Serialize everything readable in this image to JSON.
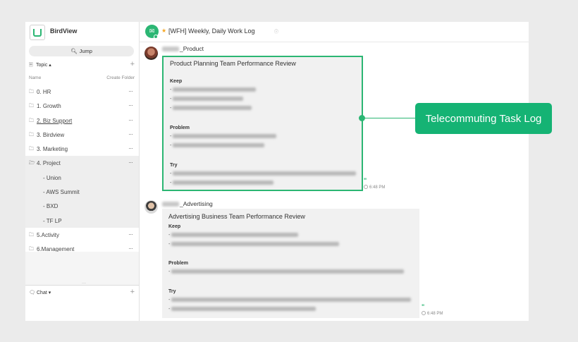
{
  "sidebar": {
    "app_name": "BirdView",
    "jump_label": "Jump",
    "topic_label": "Topic ▴",
    "col_name": "Name",
    "col_create": "Create Folder",
    "items": [
      {
        "label": "0. HR"
      },
      {
        "label": "1. Growth"
      },
      {
        "label": "2. Biz Support"
      },
      {
        "label": "3. Birdview"
      },
      {
        "label": "3. Marketing"
      },
      {
        "label": "4. Project"
      },
      {
        "label": "Union"
      },
      {
        "label": "AWS Summit"
      },
      {
        "label": "BXD"
      },
      {
        "label": "TF LP"
      },
      {
        "label": "5.Activity"
      },
      {
        "label": "6.Management"
      }
    ],
    "chat_label": "Chat ▾"
  },
  "header": {
    "title": "[WFH] Weekly, Daily Work Log"
  },
  "messages": [
    {
      "sender": "_Product",
      "title": "Product Planning Team Performance Review",
      "sections": [
        "Keep",
        "Problem",
        "Try"
      ],
      "time": "6:48 PM"
    },
    {
      "sender": "_Advertising",
      "title": "Advertising Business Team Performance Review",
      "sections": [
        "Keep",
        "Problem",
        "Try"
      ],
      "time": "6:48 PM"
    }
  ],
  "line_prefix": "-",
  "quote_mark": "\"",
  "callout": "Telecommuting Task Log",
  "colors": {
    "accent": "#2bb673",
    "callout_bg": "#15b374",
    "star": "#f5a623"
  },
  "icons": [
    "logo-icon",
    "search-icon",
    "topic-icon",
    "folder-icon",
    "more-icon",
    "plus-icon",
    "chat-icon",
    "star-icon",
    "info-icon",
    "clock-icon"
  ]
}
